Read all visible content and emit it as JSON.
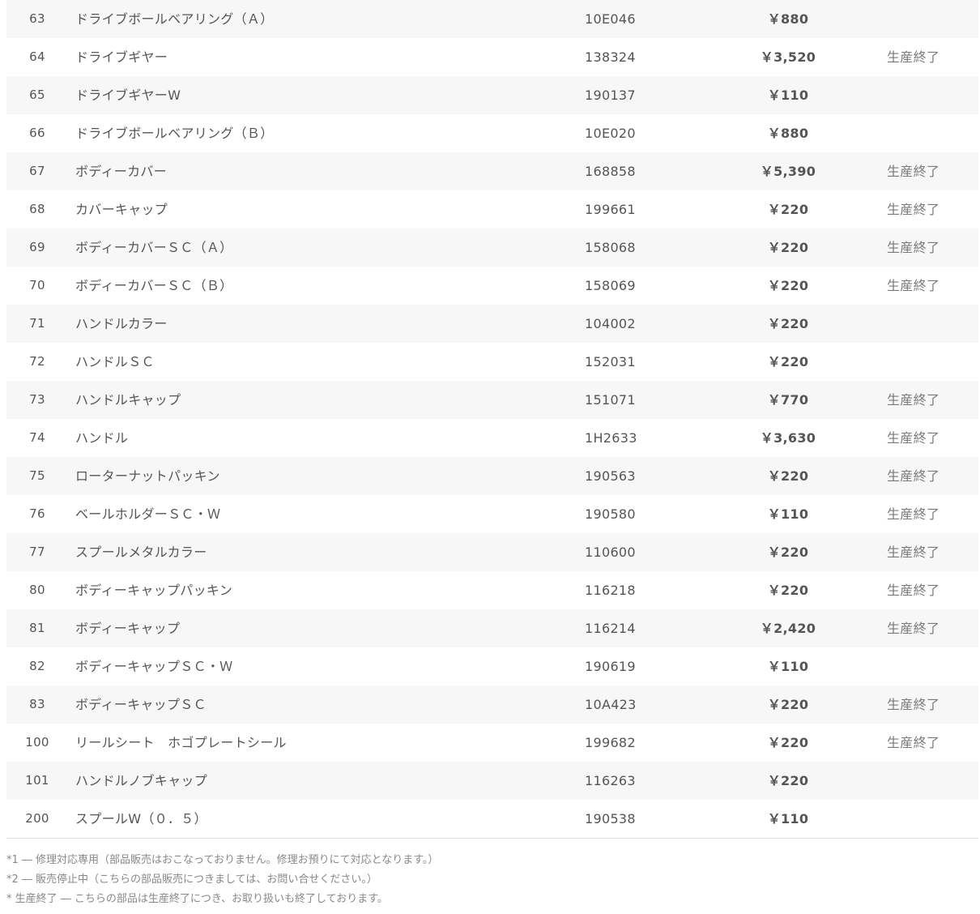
{
  "rows": [
    {
      "no": "63",
      "name": "ドライブボールベアリング（Ａ）",
      "code": "10E046",
      "price": "￥880",
      "note": ""
    },
    {
      "no": "64",
      "name": "ドライブギヤー",
      "code": "138324",
      "price": "￥3,520",
      "note": "生産終了"
    },
    {
      "no": "65",
      "name": "ドライブギヤーW",
      "code": "190137",
      "price": "￥110",
      "note": ""
    },
    {
      "no": "66",
      "name": "ドライブボールベアリング（Ｂ）",
      "code": "10E020",
      "price": "￥880",
      "note": ""
    },
    {
      "no": "67",
      "name": "ボディーカバー",
      "code": "168858",
      "price": "￥5,390",
      "note": "生産終了"
    },
    {
      "no": "68",
      "name": "カバーキャップ",
      "code": "199661",
      "price": "￥220",
      "note": "生産終了"
    },
    {
      "no": "69",
      "name": "ボディーカバーＳＣ（Ａ）",
      "code": "158068",
      "price": "￥220",
      "note": "生産終了"
    },
    {
      "no": "70",
      "name": "ボディーカバーＳＣ（Ｂ）",
      "code": "158069",
      "price": "￥220",
      "note": "生産終了"
    },
    {
      "no": "71",
      "name": "ハンドルカラー",
      "code": "104002",
      "price": "￥220",
      "note": ""
    },
    {
      "no": "72",
      "name": "ハンドルＳＣ",
      "code": "152031",
      "price": "￥220",
      "note": ""
    },
    {
      "no": "73",
      "name": "ハンドルキャップ",
      "code": "151071",
      "price": "￥770",
      "note": "生産終了"
    },
    {
      "no": "74",
      "name": "ハンドル",
      "code": "1H2633",
      "price": "￥3,630",
      "note": "生産終了"
    },
    {
      "no": "75",
      "name": "ローターナットパッキン",
      "code": "190563",
      "price": "￥220",
      "note": "生産終了"
    },
    {
      "no": "76",
      "name": "ベールホルダーＳＣ・Ｗ",
      "code": "190580",
      "price": "￥110",
      "note": "生産終了"
    },
    {
      "no": "77",
      "name": "スプールメタルカラー",
      "code": "110600",
      "price": "￥220",
      "note": "生産終了"
    },
    {
      "no": "80",
      "name": "ボディーキャップパッキン",
      "code": "116218",
      "price": "￥220",
      "note": "生産終了"
    },
    {
      "no": "81",
      "name": "ボディーキャップ",
      "code": "116214",
      "price": "￥2,420",
      "note": "生産終了"
    },
    {
      "no": "82",
      "name": "ボディーキャップＳＣ・Ｗ",
      "code": "190619",
      "price": "￥110",
      "note": ""
    },
    {
      "no": "83",
      "name": "ボディーキャップＳＣ",
      "code": "10A423",
      "price": "￥220",
      "note": "生産終了"
    },
    {
      "no": "100",
      "name": "リールシート　ホゴプレートシール",
      "code": "199682",
      "price": "￥220",
      "note": "生産終了"
    },
    {
      "no": "101",
      "name": "ハンドルノブキャップ",
      "code": "116263",
      "price": "￥220",
      "note": ""
    },
    {
      "no": "200",
      "name": "スプールW（０．５）",
      "code": "190538",
      "price": "￥110",
      "note": ""
    }
  ],
  "footnotes": [
    "*1 ― 修理対応専用（部品販売はおこなっておりません。修理お預りにて対応となります。）",
    "*2 ― 販売停止中（こちらの部品販売につきましては、お問い合せください。）",
    "* 生産終了 ― こちらの部品は生産終了につき、お取り扱いも終了しております。"
  ]
}
